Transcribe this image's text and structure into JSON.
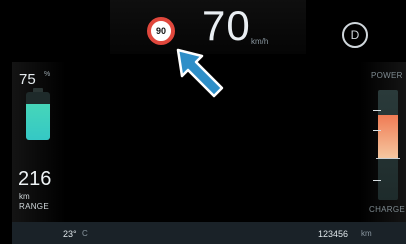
{
  "speed": {
    "limit": "90",
    "value": "70",
    "unit": "km/h"
  },
  "gear": "D",
  "battery": {
    "percent": "75",
    "percent_unit": "%",
    "level": 0.75
  },
  "range": {
    "value": "216",
    "unit": "km",
    "label": "RANGE"
  },
  "power": {
    "top_label": "POWER",
    "bottom_label": "CHARGE",
    "level": 0.3
  },
  "status": {
    "temperature": "23°",
    "temperature_unit": "C",
    "odometer": "123456",
    "odometer_unit": "km"
  },
  "colors": {
    "speed_limit_ring": "#e0473c",
    "battery_fill": "#3fd0bf",
    "power_fill": "#f07b54",
    "pointer": "#2f8fc8"
  },
  "icons": {
    "pointer": "arrow-pointer-icon"
  }
}
